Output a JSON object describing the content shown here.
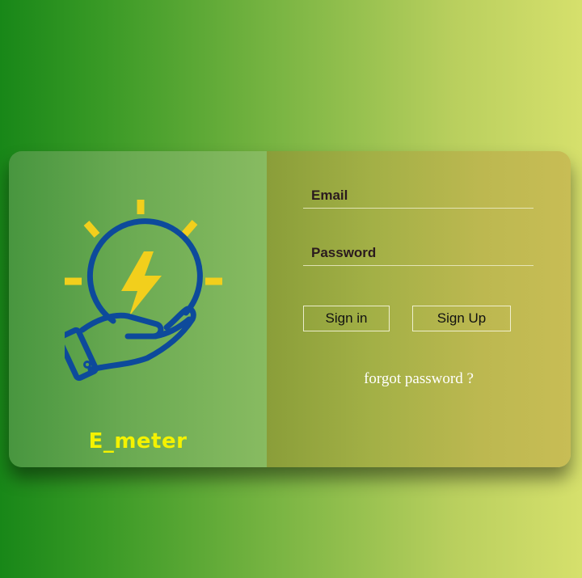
{
  "brand": {
    "name": "E_meter",
    "logo_icon": "hand-holding-lightbulb-icon",
    "colors": {
      "text": "#f4f200",
      "icon_blue": "#0d4a9b",
      "icon_yellow": "#f2cf1c"
    }
  },
  "login_form": {
    "email": {
      "placeholder": "Email",
      "value": ""
    },
    "password": {
      "placeholder": "Password",
      "value": ""
    },
    "sign_in_label": "Sign in",
    "sign_up_label": "Sign Up",
    "forgot_password_label": "forgot password ?"
  }
}
